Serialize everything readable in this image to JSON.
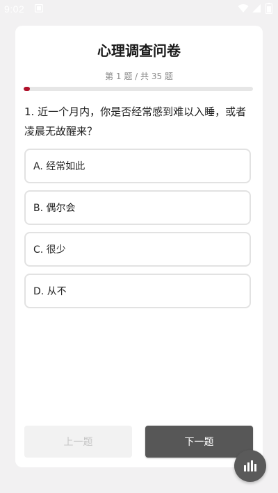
{
  "status_bar": {
    "time": "9:02"
  },
  "survey": {
    "title": "心理调查问卷",
    "progress_text": "第 1 题 / 共 35 题",
    "current": 1,
    "total": 35,
    "progress_color": "#b0102a"
  },
  "question": {
    "text": "1. 近一个月内，你是否经常感到难以入睡，或者凌晨无故醒来？",
    "options": [
      {
        "label": "A. 经常如此"
      },
      {
        "label": "B. 偶尔会"
      },
      {
        "label": "C. 很少"
      },
      {
        "label": "D. 从不"
      }
    ]
  },
  "navigation": {
    "prev_label": "上一题",
    "next_label": "下一题"
  },
  "fab": {
    "icon": "bar-chart-icon"
  }
}
